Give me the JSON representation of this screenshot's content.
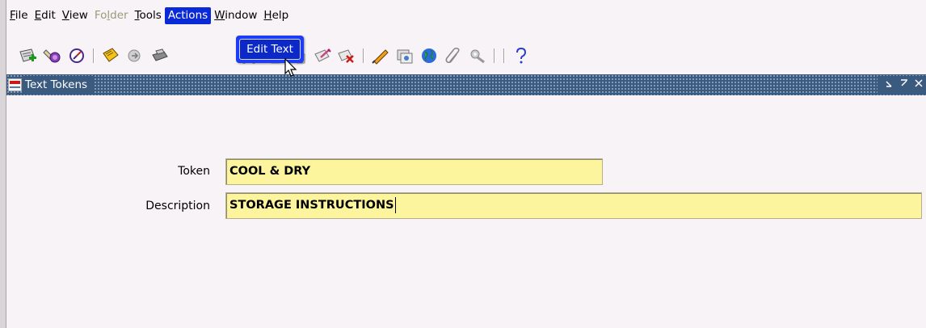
{
  "menubar": {
    "items": [
      {
        "label": "File",
        "ul": "F",
        "rest": "ile",
        "state": "normal"
      },
      {
        "label": "Edit",
        "ul": "E",
        "rest": "dit",
        "state": "normal"
      },
      {
        "label": "View",
        "ul": "V",
        "rest": "iew",
        "state": "normal"
      },
      {
        "label": "Folder",
        "pre": "Fo",
        "ul": "l",
        "rest": "der",
        "state": "disabled"
      },
      {
        "label": "Tools",
        "ul": "T",
        "rest": "ools",
        "state": "normal"
      },
      {
        "label": "Actions",
        "state": "active"
      },
      {
        "label": "Window",
        "ul": "W",
        "rest": "indow",
        "state": "normal"
      },
      {
        "label": "Help",
        "ul": "H",
        "rest": "elp",
        "state": "normal"
      }
    ]
  },
  "actions_menu": {
    "items": [
      "Edit Text"
    ]
  },
  "toolbar": {
    "icons": [
      "new-record-icon",
      "find-icon",
      "navigator-icon",
      "save-icon",
      "next-step-icon",
      "print-icon",
      "close-form-icon",
      "cut-icon",
      "copy-icon",
      "paste-icon",
      "clear-record-icon",
      "delete-record-icon",
      "edit-field-icon",
      "zoom-icon",
      "translations-icon",
      "attachments-icon",
      "folder-tools-icon",
      "help-icon"
    ]
  },
  "window": {
    "title": "Text Tokens",
    "controls": [
      "minimize",
      "maximize",
      "close"
    ]
  },
  "form": {
    "token_label": "Token",
    "token_value": "COOL & DRY",
    "description_label": "Description",
    "description_value": "STORAGE INSTRUCTIONS"
  },
  "colors": {
    "menu_active": "#0a2ad8",
    "title_bar": "#3b5a7f",
    "field_bg": "#fdf59e",
    "background": "#f7f3f7"
  }
}
